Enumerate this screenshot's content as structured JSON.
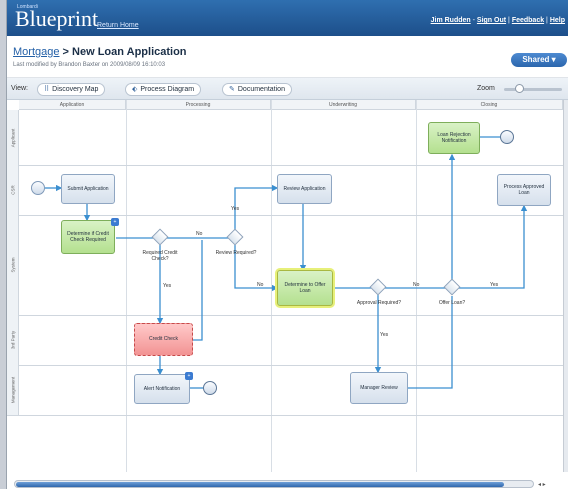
{
  "app": {
    "logo_small": "Lombardi",
    "logo": "Blueprint",
    "return_home": "Return Home",
    "user": "Jim Rudden",
    "sign_out": "Sign Out",
    "feedback": "Feedback",
    "help": "Help"
  },
  "header": {
    "breadcrumb_parent": "Mortgage",
    "breadcrumb_sep": " > ",
    "title": "New Loan Application",
    "modified": "Last modified by Brandon Baxter on 2009/08/09 16:10:03",
    "shared_label": "Shared"
  },
  "viewbar": {
    "label": "View:",
    "discovery_map": "Discovery Map",
    "process_diagram": "Process Diagram",
    "documentation": "Documentation",
    "zoom_label": "Zoom"
  },
  "diagram": {
    "columns": [
      "Application",
      "Processing",
      "Underwriting",
      "Closing"
    ],
    "lanes": [
      "Applicant",
      "CSR",
      "System",
      "3rd Party",
      "Management"
    ],
    "tasks": {
      "submit_application": "Submit Application",
      "determine_credit": "Determine if Credit Check Required",
      "credit_check": "Credit Check",
      "alert_notification": "Alert Notification",
      "review_application": "Review Application",
      "determine_offer": "Determine to Offer Loan",
      "manager_review": "Manager Review",
      "loan_rejection": "Loan Rejection Notification",
      "process_approved": "Process Approved Loan"
    },
    "gateways": {
      "required_credit": "Required Credit Check?",
      "review_required": "Review Required?",
      "approval_required": "Approval Required?",
      "offer_loan": "Offer Loan?"
    },
    "edge_labels": {
      "yes": "Yes",
      "no": "No"
    },
    "badge": "+"
  },
  "colors": {
    "topbar": "#2f6fb0",
    "flow_line": "#3b8fd0",
    "task_green": "#b4e08f",
    "task_red": "#f29393"
  }
}
